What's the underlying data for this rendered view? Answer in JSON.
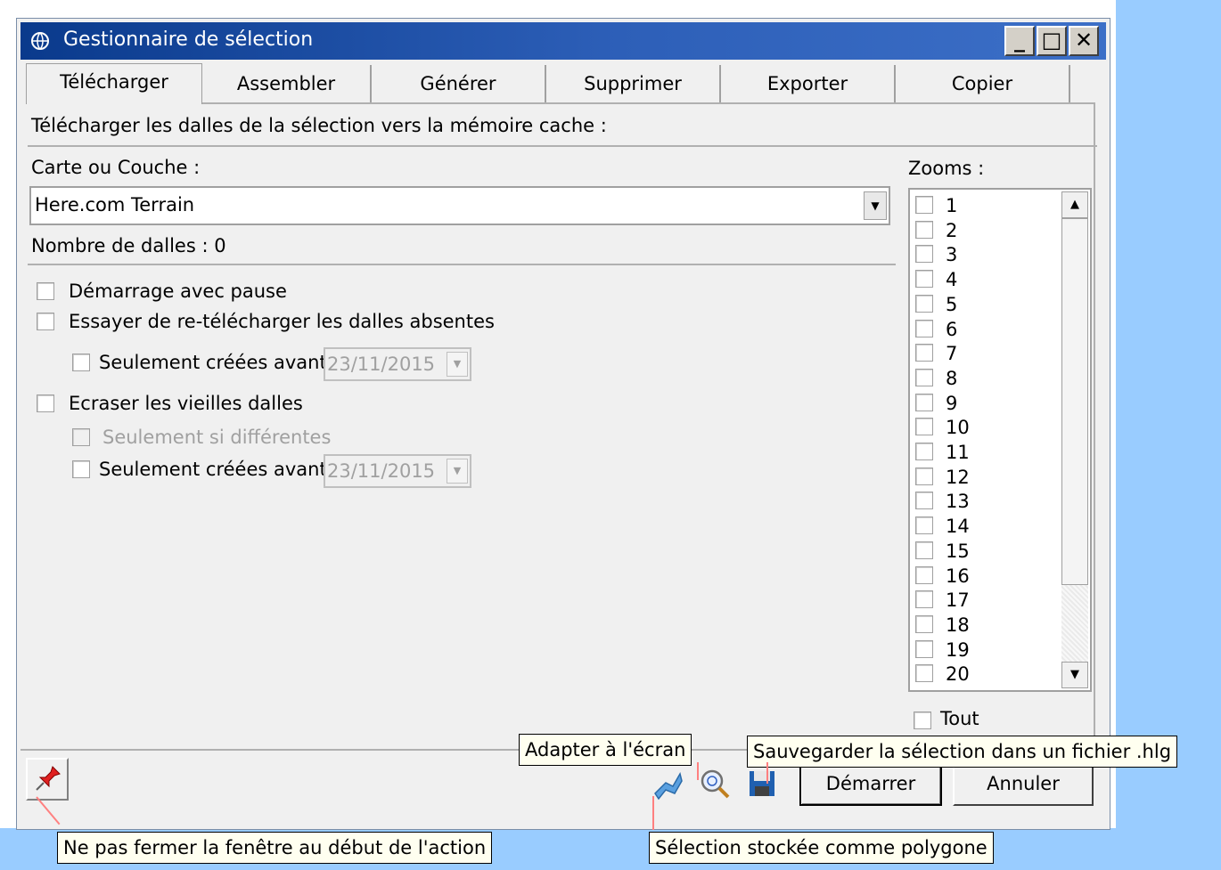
{
  "window": {
    "title": "Gestionnaire de sélection",
    "controls": {
      "minimize": "_",
      "maximize": "□",
      "close": "✕"
    }
  },
  "tabs": [
    {
      "label": "Télécharger",
      "active": true
    },
    {
      "label": "Assembler",
      "active": false
    },
    {
      "label": "Générer",
      "active": false
    },
    {
      "label": "Supprimer",
      "active": false
    },
    {
      "label": "Exporter",
      "active": false
    },
    {
      "label": "Copier",
      "active": false
    }
  ],
  "download": {
    "heading": "Télécharger les dalles de la sélection vers la mémoire cache :",
    "map_label": "Carte ou Couche :",
    "map_value": "Here.com Terrain",
    "tile_count": "Nombre de dalles : 0",
    "options": {
      "start_paused": "Démarrage avec pause",
      "retry_missing": "Essayer de re-télécharger les dalles absentes",
      "retry_only_before": "Seulement créées avant",
      "retry_date": "23/11/2015",
      "overwrite_old": "Ecraser les vieilles dalles",
      "overwrite_only_different": "Seulement si différentes",
      "overwrite_only_before": "Seulement créées avant",
      "overwrite_date": "23/11/2015"
    }
  },
  "zooms": {
    "label": "Zooms :",
    "items": [
      "1",
      "2",
      "3",
      "4",
      "5",
      "6",
      "7",
      "8",
      "9",
      "10",
      "11",
      "12",
      "13",
      "14",
      "15",
      "16",
      "17",
      "18",
      "19",
      "20"
    ],
    "all_label": "Tout"
  },
  "footer": {
    "start_button": "Démarrer",
    "cancel_button": "Annuler"
  },
  "callouts": {
    "pin": "Ne pas fermer la fenêtre au début de l'action",
    "fit": "Adapter à l'écran",
    "save": "Sauvegarder la sélection dans un fichier .hlg",
    "polygon": "Sélection stockée comme polygone"
  },
  "colors": {
    "title_bar": "#2d5fb8",
    "background_accent": "#99ccff",
    "callout_bg": "#fffff0",
    "leader_line": "#ff8080"
  },
  "icons": {
    "app": "app-globe-icon",
    "pin": "pushpin-icon",
    "polygon": "polygon-icon",
    "fit": "zoom-fit-icon",
    "save": "floppy-disk-icon"
  }
}
